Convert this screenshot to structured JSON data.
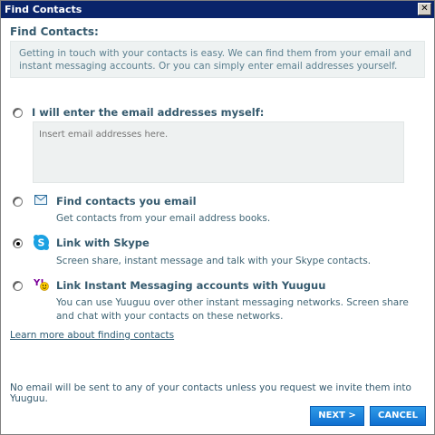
{
  "window": {
    "title": "Find Contacts",
    "close_glyph": "✕"
  },
  "heading": "Find Contacts:",
  "intro": "Getting in touch with your contacts is easy.  We can find them from your email and instant messaging accounts.  Or you can simply enter email addresses yourself.",
  "options": {
    "manual": {
      "label": "I will enter the email addresses myself:",
      "checked": false
    },
    "email": {
      "label": "Find contacts you email",
      "desc": "Get contacts from your email address books.",
      "icon": "envelope-icon",
      "checked": false
    },
    "skype": {
      "label": "Link with Skype",
      "desc": "Screen share, instant message and talk with your Skype contacts.",
      "icon": "skype-icon",
      "checked": true
    },
    "im": {
      "label": "Link Instant Messaging accounts with Yuuguu",
      "desc": "You can use Yuuguu over other instant messaging networks. Screen share and chat with your contacts on these networks.",
      "icon": "yahoo-messenger-icon",
      "checked": false
    }
  },
  "email_box": {
    "placeholder": "Insert email addresses here."
  },
  "learn_more": "Learn more about finding contacts",
  "note": "No email will be sent to any of your contacts unless you request we invite them into Yuuguu.",
  "buttons": {
    "next": "NEXT >",
    "cancel": "CANCEL"
  },
  "colors": {
    "titlebar": "#0a246a",
    "heading": "#355a6e",
    "button": "#1a82dc",
    "panel": "#eef2f2"
  }
}
